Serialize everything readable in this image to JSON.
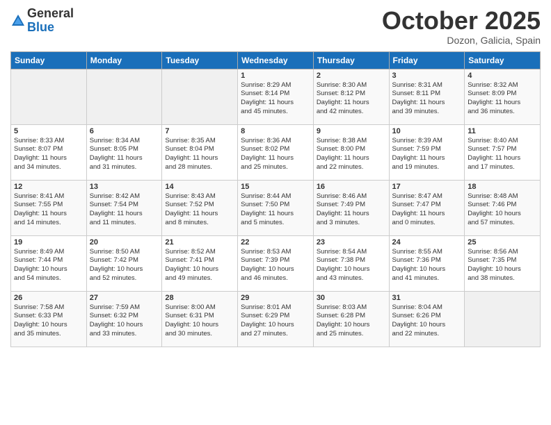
{
  "logo": {
    "general": "General",
    "blue": "Blue"
  },
  "title": "October 2025",
  "location": "Dozon, Galicia, Spain",
  "days_of_week": [
    "Sunday",
    "Monday",
    "Tuesday",
    "Wednesday",
    "Thursday",
    "Friday",
    "Saturday"
  ],
  "weeks": [
    [
      {
        "day": "",
        "info": ""
      },
      {
        "day": "",
        "info": ""
      },
      {
        "day": "",
        "info": ""
      },
      {
        "day": "1",
        "info": "Sunrise: 8:29 AM\nSunset: 8:14 PM\nDaylight: 11 hours\nand 45 minutes."
      },
      {
        "day": "2",
        "info": "Sunrise: 8:30 AM\nSunset: 8:12 PM\nDaylight: 11 hours\nand 42 minutes."
      },
      {
        "day": "3",
        "info": "Sunrise: 8:31 AM\nSunset: 8:11 PM\nDaylight: 11 hours\nand 39 minutes."
      },
      {
        "day": "4",
        "info": "Sunrise: 8:32 AM\nSunset: 8:09 PM\nDaylight: 11 hours\nand 36 minutes."
      }
    ],
    [
      {
        "day": "5",
        "info": "Sunrise: 8:33 AM\nSunset: 8:07 PM\nDaylight: 11 hours\nand 34 minutes."
      },
      {
        "day": "6",
        "info": "Sunrise: 8:34 AM\nSunset: 8:05 PM\nDaylight: 11 hours\nand 31 minutes."
      },
      {
        "day": "7",
        "info": "Sunrise: 8:35 AM\nSunset: 8:04 PM\nDaylight: 11 hours\nand 28 minutes."
      },
      {
        "day": "8",
        "info": "Sunrise: 8:36 AM\nSunset: 8:02 PM\nDaylight: 11 hours\nand 25 minutes."
      },
      {
        "day": "9",
        "info": "Sunrise: 8:38 AM\nSunset: 8:00 PM\nDaylight: 11 hours\nand 22 minutes."
      },
      {
        "day": "10",
        "info": "Sunrise: 8:39 AM\nSunset: 7:59 PM\nDaylight: 11 hours\nand 19 minutes."
      },
      {
        "day": "11",
        "info": "Sunrise: 8:40 AM\nSunset: 7:57 PM\nDaylight: 11 hours\nand 17 minutes."
      }
    ],
    [
      {
        "day": "12",
        "info": "Sunrise: 8:41 AM\nSunset: 7:55 PM\nDaylight: 11 hours\nand 14 minutes."
      },
      {
        "day": "13",
        "info": "Sunrise: 8:42 AM\nSunset: 7:54 PM\nDaylight: 11 hours\nand 11 minutes."
      },
      {
        "day": "14",
        "info": "Sunrise: 8:43 AM\nSunset: 7:52 PM\nDaylight: 11 hours\nand 8 minutes."
      },
      {
        "day": "15",
        "info": "Sunrise: 8:44 AM\nSunset: 7:50 PM\nDaylight: 11 hours\nand 5 minutes."
      },
      {
        "day": "16",
        "info": "Sunrise: 8:46 AM\nSunset: 7:49 PM\nDaylight: 11 hours\nand 3 minutes."
      },
      {
        "day": "17",
        "info": "Sunrise: 8:47 AM\nSunset: 7:47 PM\nDaylight: 11 hours\nand 0 minutes."
      },
      {
        "day": "18",
        "info": "Sunrise: 8:48 AM\nSunset: 7:46 PM\nDaylight: 10 hours\nand 57 minutes."
      }
    ],
    [
      {
        "day": "19",
        "info": "Sunrise: 8:49 AM\nSunset: 7:44 PM\nDaylight: 10 hours\nand 54 minutes."
      },
      {
        "day": "20",
        "info": "Sunrise: 8:50 AM\nSunset: 7:42 PM\nDaylight: 10 hours\nand 52 minutes."
      },
      {
        "day": "21",
        "info": "Sunrise: 8:52 AM\nSunset: 7:41 PM\nDaylight: 10 hours\nand 49 minutes."
      },
      {
        "day": "22",
        "info": "Sunrise: 8:53 AM\nSunset: 7:39 PM\nDaylight: 10 hours\nand 46 minutes."
      },
      {
        "day": "23",
        "info": "Sunrise: 8:54 AM\nSunset: 7:38 PM\nDaylight: 10 hours\nand 43 minutes."
      },
      {
        "day": "24",
        "info": "Sunrise: 8:55 AM\nSunset: 7:36 PM\nDaylight: 10 hours\nand 41 minutes."
      },
      {
        "day": "25",
        "info": "Sunrise: 8:56 AM\nSunset: 7:35 PM\nDaylight: 10 hours\nand 38 minutes."
      }
    ],
    [
      {
        "day": "26",
        "info": "Sunrise: 7:58 AM\nSunset: 6:33 PM\nDaylight: 10 hours\nand 35 minutes."
      },
      {
        "day": "27",
        "info": "Sunrise: 7:59 AM\nSunset: 6:32 PM\nDaylight: 10 hours\nand 33 minutes."
      },
      {
        "day": "28",
        "info": "Sunrise: 8:00 AM\nSunset: 6:31 PM\nDaylight: 10 hours\nand 30 minutes."
      },
      {
        "day": "29",
        "info": "Sunrise: 8:01 AM\nSunset: 6:29 PM\nDaylight: 10 hours\nand 27 minutes."
      },
      {
        "day": "30",
        "info": "Sunrise: 8:03 AM\nSunset: 6:28 PM\nDaylight: 10 hours\nand 25 minutes."
      },
      {
        "day": "31",
        "info": "Sunrise: 8:04 AM\nSunset: 6:26 PM\nDaylight: 10 hours\nand 22 minutes."
      },
      {
        "day": "",
        "info": ""
      }
    ]
  ]
}
